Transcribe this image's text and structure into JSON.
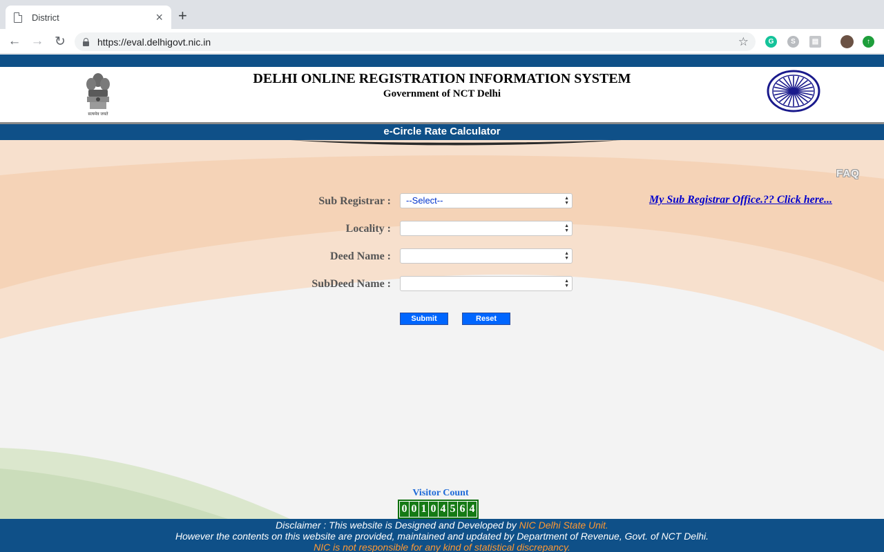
{
  "browser": {
    "tab_title": "District",
    "tab_close": "×",
    "new_tab": "+",
    "url": "https://eval.delhigovt.nic.in",
    "nav_back": "←",
    "nav_forward": "→",
    "nav_reload": "↻",
    "bookmark_star": "☆",
    "extensions": [
      {
        "name": "grammarly-icon",
        "glyph": "G",
        "color": "#15c39a"
      },
      {
        "name": "skype-icon",
        "glyph": "S",
        "color": "#b9bcc0"
      },
      {
        "name": "reader-icon",
        "glyph": "▤",
        "color": "#c5c7ca"
      },
      {
        "name": "avatar-icon",
        "glyph": "",
        "color": "#6b5244"
      },
      {
        "name": "upload-icon",
        "glyph": "↑",
        "color": "#1e9e3b"
      }
    ]
  },
  "header": {
    "title": "DELHI ONLINE REGISTRATION INFORMATION SYSTEM",
    "subtitle": "Government of NCT Delhi",
    "emblem_motto": "सत्यमेव जयते",
    "colors": {
      "navy": "#0f5088",
      "chakra": "#1a1a8c"
    }
  },
  "calculator": {
    "title": "e-Circle Rate Calculator",
    "faq": "FAQ",
    "sub_registrar_link": "My Sub Registrar Office.?? Click here...",
    "fields": [
      {
        "label": "Sub Registrar :",
        "value": "--Select--"
      },
      {
        "label": "Locality :",
        "value": ""
      },
      {
        "label": "Deed Name :",
        "value": ""
      },
      {
        "label": "SubDeed Name :",
        "value": ""
      }
    ],
    "submit": "Submit",
    "reset": "Reset"
  },
  "visitor": {
    "label": "Visitor Count",
    "digits": [
      "0",
      "0",
      "1",
      "0",
      "4",
      "5",
      "6",
      "4"
    ]
  },
  "footer": {
    "line1_prefix": "Disclaimer : This website is Designed and Developed by ",
    "line1_org": "NIC Delhi State Unit.",
    "line2": "However the contents on this website are provided, maintained and updated by Department of Revenue, Govt. of NCT Delhi.",
    "line3": "NIC is not responsible for any kind of statistical discrepancy."
  }
}
